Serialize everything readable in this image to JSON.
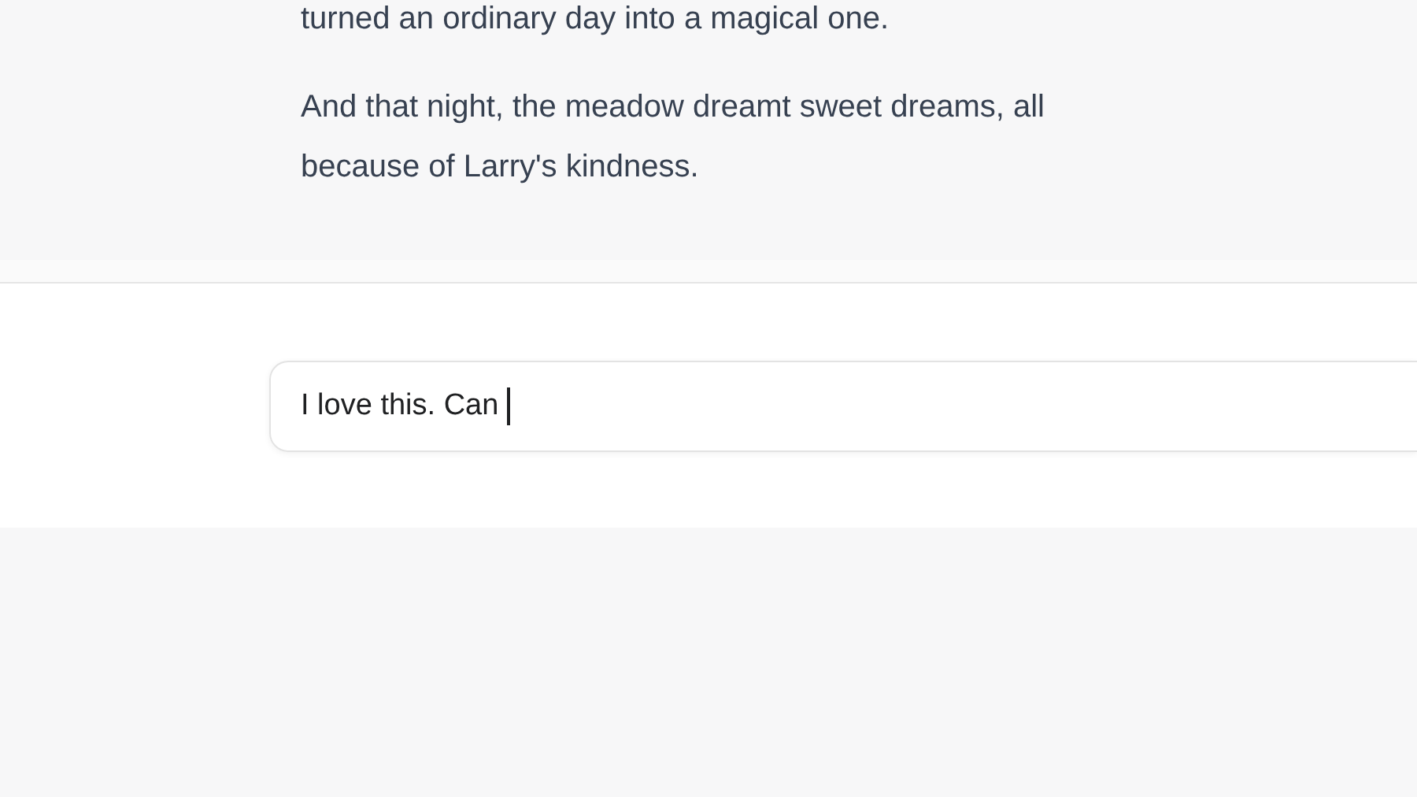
{
  "conversation": {
    "paragraphs": [
      "turned an ordinary day into a magical one.",
      "And that night, the meadow dreamt sweet dreams, all because of Larry's kindness."
    ]
  },
  "composer": {
    "value": "I love this. Can "
  }
}
